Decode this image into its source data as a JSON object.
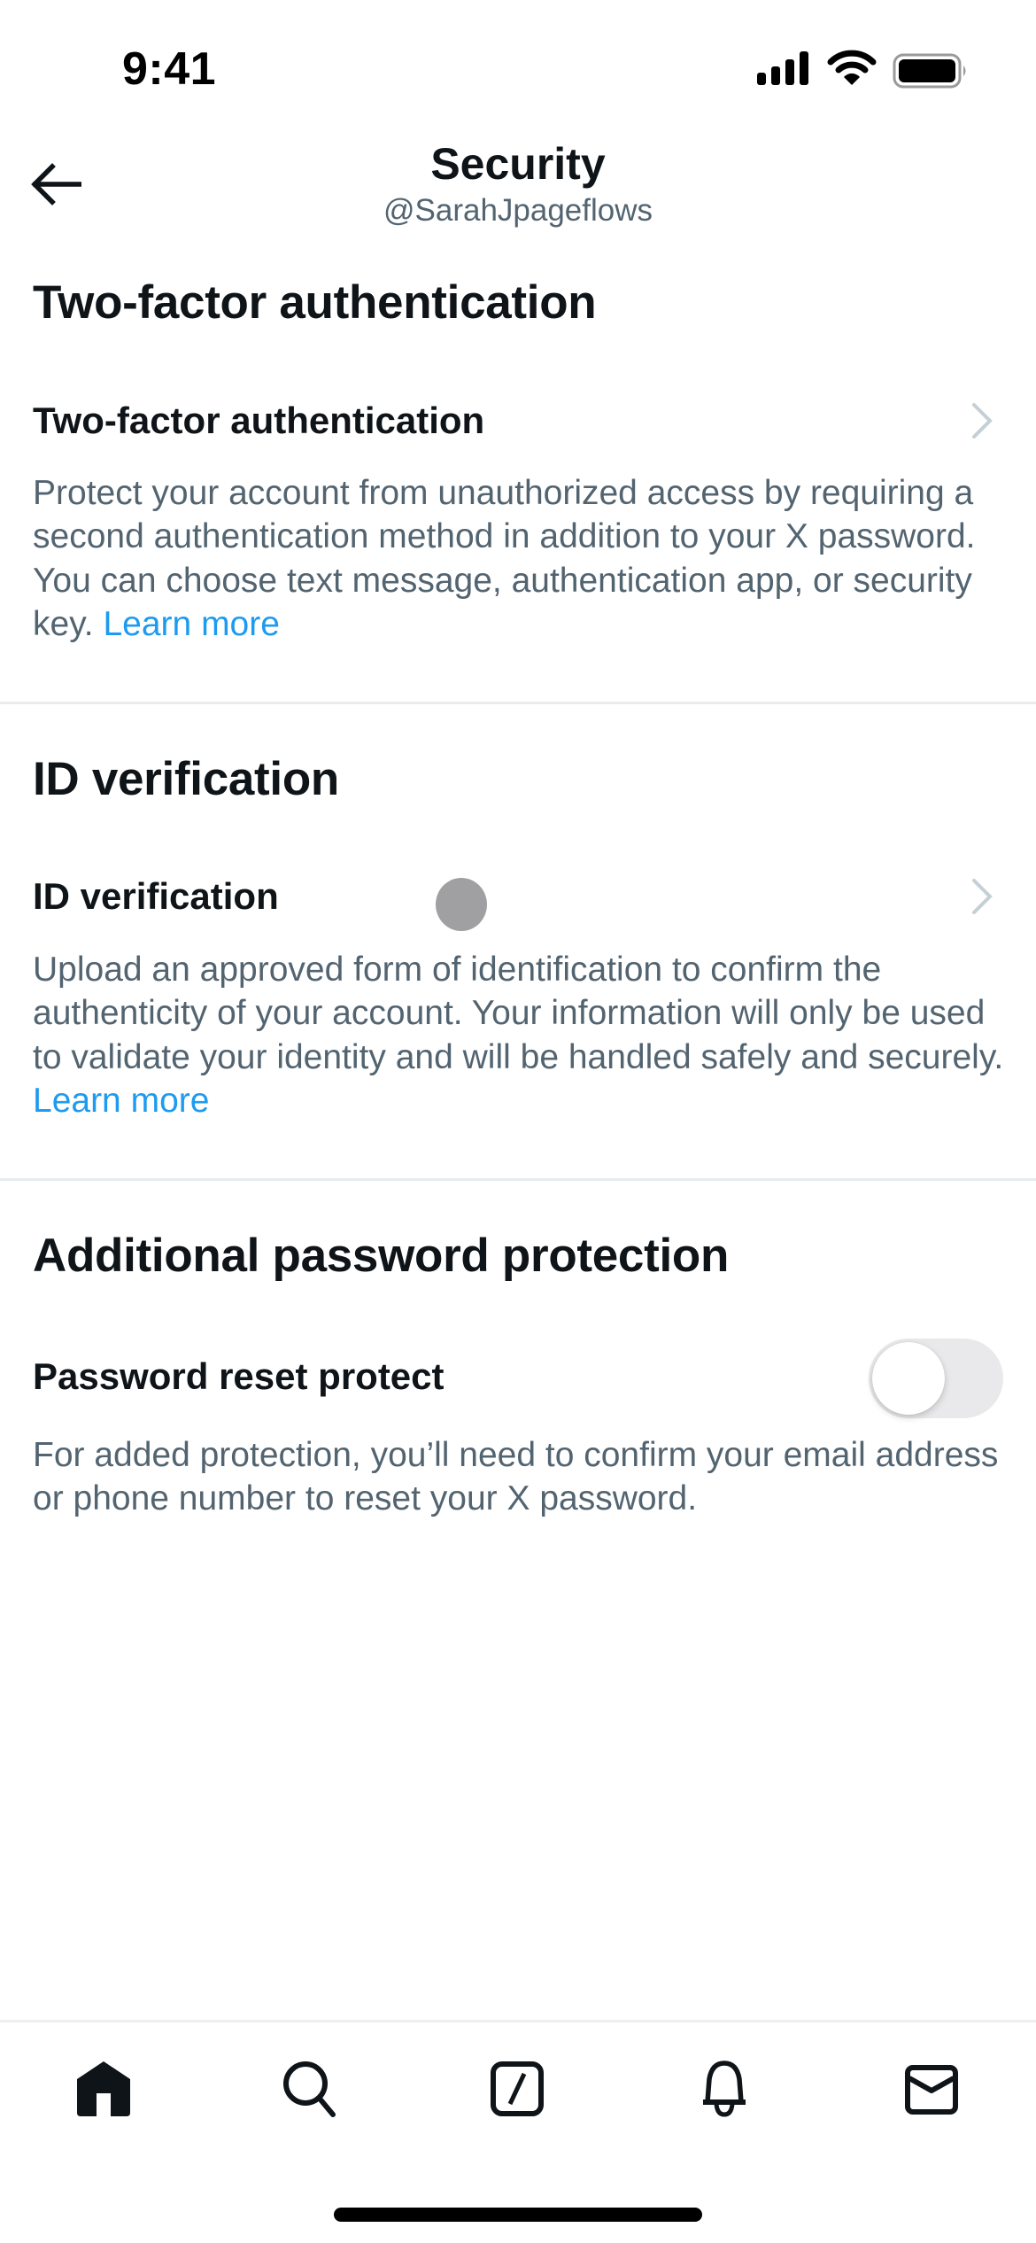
{
  "status_bar": {
    "time": "9:41",
    "icons": [
      "cellular-signal-icon",
      "wifi-icon",
      "battery-icon"
    ]
  },
  "header": {
    "title": "Security",
    "subtitle": "@SarahJpageflows",
    "back_icon": "arrow-left-icon"
  },
  "sections": [
    {
      "heading": "Two-factor authentication",
      "row_title": "Two-factor authentication",
      "row_control": "chevron",
      "description": "Protect your account from unauthorized access by requiring a second authentication method in addition to your X password. You can choose text message, authentication app, or security key.",
      "link": "Learn more"
    },
    {
      "heading": "ID verification",
      "row_title": "ID verification",
      "row_control": "chevron",
      "description": "Upload an approved form of identification to confirm the authenticity of your account. Your information will only be used to validate your identity and will be handled safely and securely.",
      "link": "Learn more"
    },
    {
      "heading": "Additional password protection",
      "row_title": "Password reset protect",
      "row_control": "toggle",
      "toggle_on": false,
      "description": "For added protection, you’ll need to confirm your email address or phone number to reset your X password."
    }
  ],
  "tab_bar": {
    "tabs": [
      {
        "name": "home",
        "icon": "home-icon",
        "active": true
      },
      {
        "name": "search",
        "icon": "search-icon",
        "active": false
      },
      {
        "name": "grok",
        "icon": "grok-icon",
        "active": false
      },
      {
        "name": "notifications",
        "icon": "bell-icon",
        "active": false
      },
      {
        "name": "messages",
        "icon": "mail-icon",
        "active": false
      }
    ]
  },
  "colors": {
    "text_primary": "#0f1419",
    "text_secondary": "#536471",
    "link": "#1d9bf0",
    "divider": "#e9ecee",
    "chevron": "#c4cfd6",
    "toggle_off_track": "#e9e9eb",
    "touch_indicator": "#a0a0a3"
  }
}
